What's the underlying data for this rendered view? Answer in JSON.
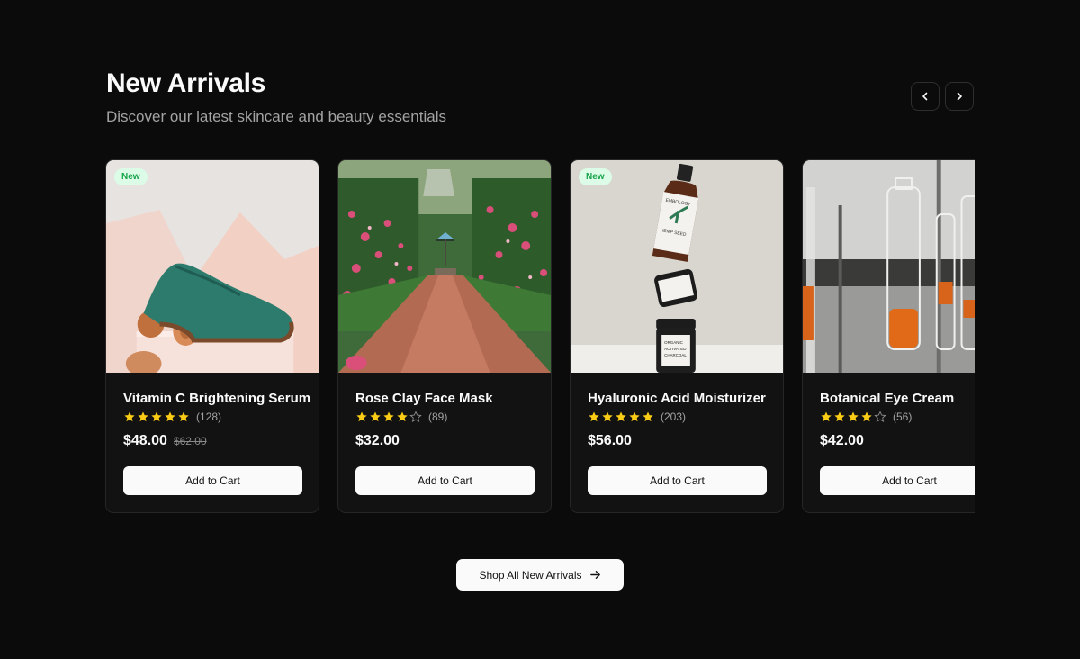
{
  "section": {
    "title": "New Arrivals",
    "subtitle": "Discover our latest skincare and beauty essentials"
  },
  "nav": {
    "prev_icon": "chevron-left-icon",
    "next_icon": "chevron-right-icon"
  },
  "products": [
    {
      "name": "Vitamin C Brightening Serum",
      "badge": "New",
      "rating": 5,
      "reviews": "(128)",
      "price": "$48.00",
      "old_price": "$62.00",
      "cta": "Add to Cart",
      "image": "green-shoe-on-pink-backdrop"
    },
    {
      "name": "Rose Clay Face Mask",
      "badge": "",
      "rating": 4,
      "reviews": "(89)",
      "price": "$32.00",
      "old_price": "",
      "cta": "Add to Cart",
      "image": "rose-garden-path"
    },
    {
      "name": "Hyaluronic Acid Moisturizer",
      "badge": "New",
      "rating": 5,
      "reviews": "(203)",
      "price": "$56.00",
      "old_price": "",
      "cta": "Add to Cart",
      "image": "stacked-skincare-jars"
    },
    {
      "name": "Botanical Eye Cream",
      "badge": "",
      "rating": 4,
      "reviews": "(56)",
      "price": "$42.00",
      "old_price": "",
      "cta": "Add to Cart",
      "image": "glass-test-tubes"
    }
  ],
  "image_labels": {
    "bottle": [
      "EMBOLOGY",
      "HEMP SEED"
    ],
    "jar": [
      "ORGANIC",
      "ACTIVATED",
      "CHARCOAL"
    ]
  },
  "footer": {
    "cta": "Shop All New Arrivals",
    "cta_icon": "arrow-right-icon"
  },
  "colors": {
    "background": "#0b0b0b",
    "card": "#121212",
    "star": "#facc15",
    "badge_bg": "#dcfce7",
    "badge_text": "#16a34a"
  }
}
